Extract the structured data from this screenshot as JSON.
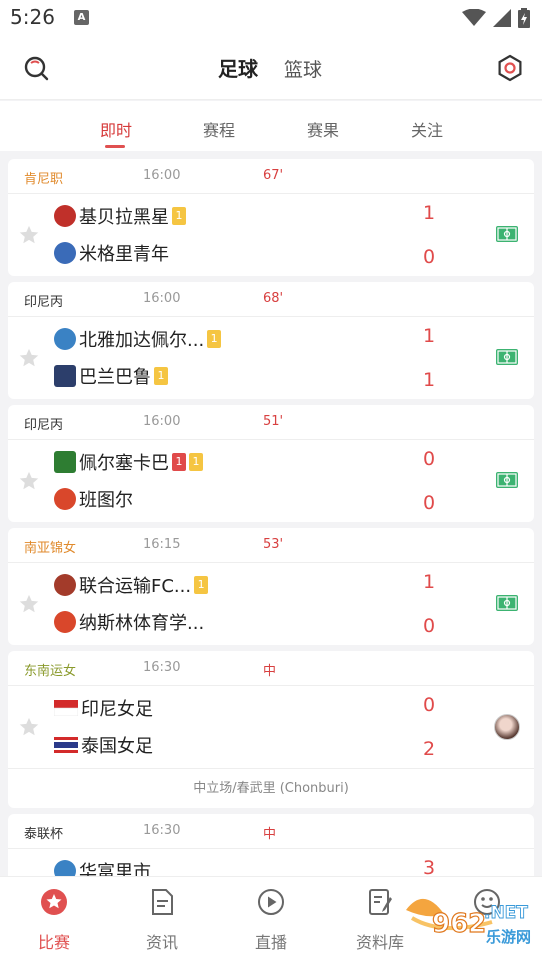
{
  "status_bar": {
    "time": "5:26",
    "badge": "A"
  },
  "header": {
    "sports": [
      {
        "label": "足球",
        "active": true
      },
      {
        "label": "篮球",
        "active": false
      }
    ]
  },
  "subtabs": [
    {
      "label": "即时",
      "active": true
    },
    {
      "label": "赛程",
      "active": false
    },
    {
      "label": "赛果",
      "active": false
    },
    {
      "label": "关注",
      "active": false
    }
  ],
  "matches": [
    {
      "league": "肯尼职",
      "league_color": "#e08a2c",
      "time": "16:00",
      "minute": "67'",
      "home": {
        "name": "基贝拉黑星",
        "crest_color": "#c0302a",
        "cards": [
          "yellow:1"
        ]
      },
      "away": {
        "name": "米格里青年",
        "crest_color": "#3a6bb8",
        "cards": []
      },
      "home_score": "1",
      "away_score": "0",
      "right": "field-icon"
    },
    {
      "league": "印尼丙",
      "league_color": "#333333",
      "time": "16:00",
      "minute": "68'",
      "home": {
        "name": "北雅加达佩尔...",
        "crest_color": "#3a82c4",
        "cards": [
          "yellow:1"
        ]
      },
      "away": {
        "name": "巴兰巴鲁",
        "crest_color": "#2c3e6b",
        "cards": [
          "yellow:1"
        ]
      },
      "home_score": "1",
      "away_score": "1",
      "right": "field-icon"
    },
    {
      "league": "印尼丙",
      "league_color": "#333333",
      "time": "16:00",
      "minute": "51'",
      "home": {
        "name": "佩尔塞卡巴",
        "crest_color": "#2e7d32",
        "cards": [
          "red:1",
          "yellow:1"
        ]
      },
      "away": {
        "name": "班图尔",
        "crest_color": "#d9472b",
        "cards": []
      },
      "home_score": "0",
      "away_score": "0",
      "right": "field-icon"
    },
    {
      "league": "南亚锦女",
      "league_color": "#e08a2c",
      "time": "16:15",
      "minute": "53'",
      "home": {
        "name": "联合运输FC...",
        "crest_color": "#a33b2a",
        "cards": [
          "yellow:1"
        ]
      },
      "away": {
        "name": "纳斯林体育学...",
        "crest_color": "#d9472b",
        "cards": []
      },
      "home_score": "1",
      "away_score": "0",
      "right": "field-icon"
    },
    {
      "league": "东南运女",
      "league_color": "#8a9a2c",
      "time": "16:30",
      "minute": "中",
      "home": {
        "name": "印尼女足",
        "crest_color": "flag-id",
        "cards": []
      },
      "away": {
        "name": "泰国女足",
        "crest_color": "flag-th",
        "cards": []
      },
      "home_score": "0",
      "away_score": "2",
      "right": "avatar",
      "venue": "中立场/春武里 (Chonburi)"
    },
    {
      "league": "泰联杯",
      "league_color": "#333333",
      "time": "16:30",
      "minute": "中",
      "home": {
        "name": "华富里市",
        "crest_color": "#3a82c4",
        "cards": []
      },
      "home_score": "3"
    }
  ],
  "tabbar": [
    {
      "label": "比赛",
      "icon": "match-icon",
      "active": true
    },
    {
      "label": "资讯",
      "icon": "news-icon",
      "active": false
    },
    {
      "label": "直播",
      "icon": "live-play-icon",
      "active": false
    },
    {
      "label": "资料库",
      "icon": "database-icon",
      "active": false
    },
    {
      "label": "",
      "icon": "profile-face-icon",
      "active": false
    }
  ],
  "watermark": {
    "text_main": "962",
    "text_net": ".NET",
    "text_sub": "乐游网"
  },
  "colors": {
    "accent": "#e05050",
    "score": "#e04a4a",
    "field": "#3cb371"
  }
}
